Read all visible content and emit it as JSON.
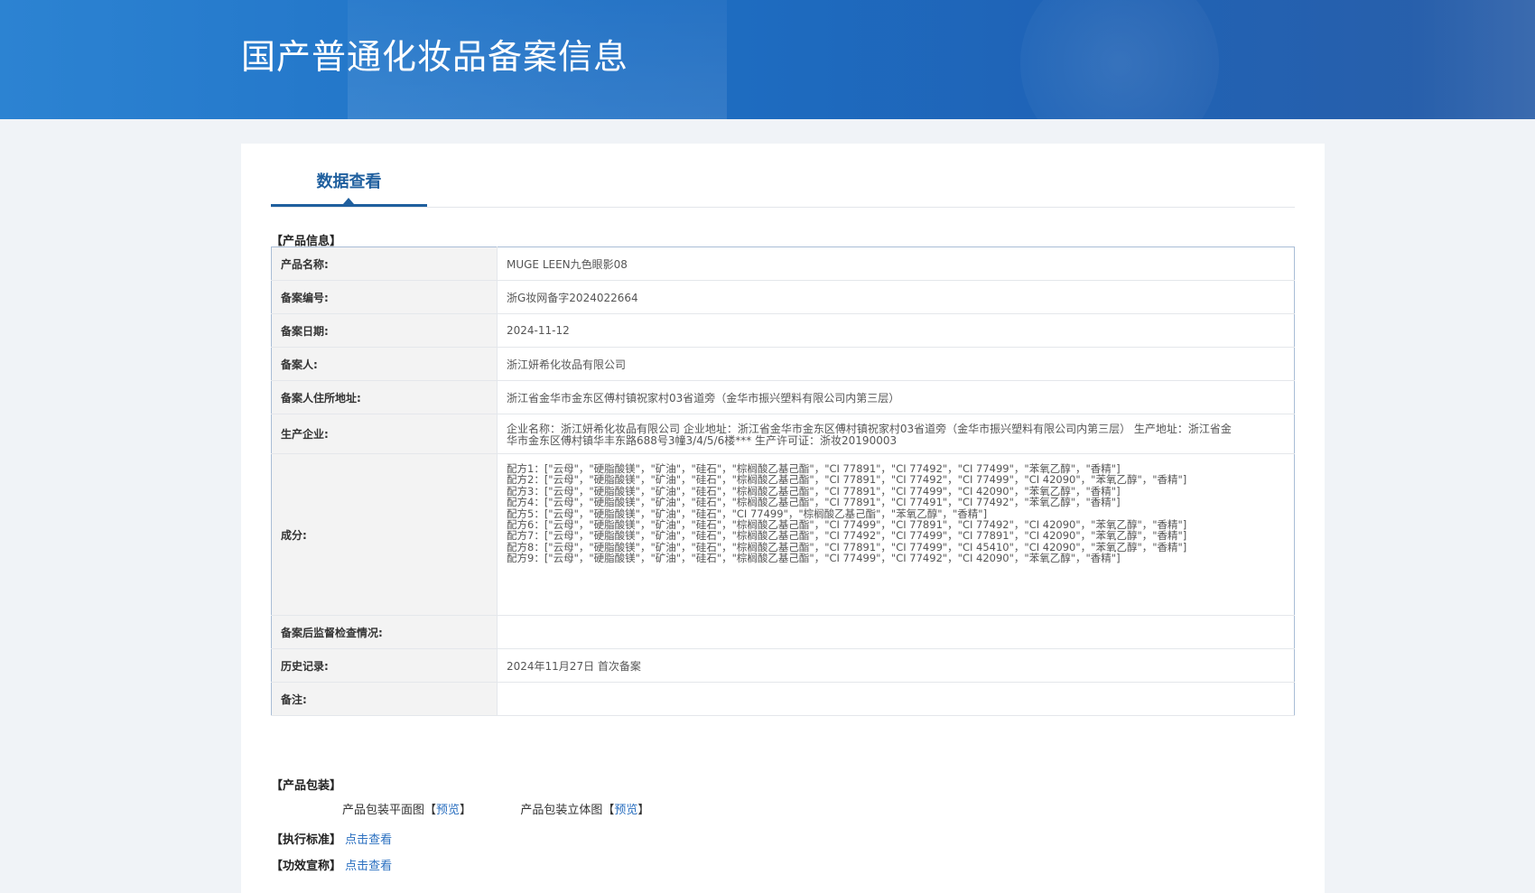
{
  "header": {
    "title": "国产普通化妆品备案信息"
  },
  "tabs": [
    {
      "label": "数据查看"
    }
  ],
  "product_info": {
    "section_title": "【产品信息】",
    "rows": [
      {
        "label": "产品名称:",
        "value": "MUGE LEEN九色眼影08"
      },
      {
        "label": "备案编号:",
        "value": "浙G妆网备字2024022664"
      },
      {
        "label": "备案日期:",
        "value": "2024-11-12"
      },
      {
        "label": "备案人:",
        "value": "浙江妍希化妆品有限公司"
      },
      {
        "label": "备案人住所地址:",
        "value": "浙江省金华市金东区傅村镇祝家村03省道旁（金华市振兴塑料有限公司内第三层）"
      },
      {
        "label": "生产企业:",
        "value": "企业名称：浙江妍希化妆品有限公司 企业地址：浙江省金华市金东区傅村镇祝家村03省道旁（金华市振兴塑料有限公司内第三层） 生产地址：浙江省金华市金东区傅村镇华丰东路688号3幢3/4/5/6楼*** 生产许可证：浙妆20190003"
      },
      {
        "label": "成分:",
        "formulas": [
          "配方1：[\"云母\"，\"硬脂酸镁\"，\"矿油\"，\"硅石\"，\"棕榈酸乙基己酯\"，\"CI 77891\"，\"CI 77492\"，\"CI 77499\"，\"苯氧乙醇\"，\"香精\"]",
          "配方2：[\"云母\"，\"硬脂酸镁\"，\"矿油\"，\"硅石\"，\"棕榈酸乙基己酯\"，\"CI 77891\"，\"CI 77492\"，\"CI 77499\"，\"CI 42090\"，\"苯氧乙醇\"，\"香精\"]",
          "配方3：[\"云母\"，\"硬脂酸镁\"，\"矿油\"，\"硅石\"，\"棕榈酸乙基己酯\"，\"CI 77891\"，\"CI 77499\"，\"CI 42090\"，\"苯氧乙醇\"，\"香精\"]",
          "配方4：[\"云母\"，\"硬脂酸镁\"，\"矿油\"，\"硅石\"，\"棕榈酸乙基己酯\"，\"CI 77891\"，\"CI 77491\"，\"CI 77492\"，\"苯氧乙醇\"，\"香精\"]",
          "配方5：[\"云母\"，\"硬脂酸镁\"，\"矿油\"，\"硅石\"，\"CI 77499\"，\"棕榈酸乙基己酯\"，\"苯氧乙醇\"，\"香精\"]",
          "配方6：[\"云母\"，\"硬脂酸镁\"，\"矿油\"，\"硅石\"，\"棕榈酸乙基己酯\"，\"CI 77499\"，\"CI 77891\"，\"CI 77492\"，\"CI 42090\"，\"苯氧乙醇\"，\"香精\"]",
          "配方7：[\"云母\"，\"硬脂酸镁\"，\"矿油\"，\"硅石\"，\"棕榈酸乙基己酯\"，\"CI 77492\"，\"CI 77499\"，\"CI 77891\"，\"CI 42090\"，\"苯氧乙醇\"，\"香精\"]",
          "配方8：[\"云母\"，\"硬脂酸镁\"，\"矿油\"，\"硅石\"，\"棕榈酸乙基己酯\"，\"CI 77891\"，\"CI 77499\"，\"CI 45410\"，\"CI 42090\"，\"苯氧乙醇\"，\"香精\"]",
          "配方9：[\"云母\"，\"硬脂酸镁\"，\"矿油\"，\"硅石\"，\"棕榈酸乙基己酯\"，\"CI 77499\"，\"CI 77492\"，\"CI 42090\"，\"苯氧乙醇\"，\"香精\"]"
        ]
      },
      {
        "label": "备案后监督检查情况:",
        "value": ""
      },
      {
        "label": "历史记录:",
        "value": "2024年11月27日 首次备案"
      },
      {
        "label": "备注:",
        "value": ""
      }
    ]
  },
  "packaging": {
    "section_title": "【产品包装】",
    "flat_label": "产品包装平面图",
    "flat_link": "预览",
    "solid_label": "产品包装立体图",
    "solid_link": "预览"
  },
  "standard": {
    "label": "【执行标准】",
    "link": "点击查看"
  },
  "efficacy": {
    "label": "【功效宣称】",
    "link": "点击查看"
  }
}
